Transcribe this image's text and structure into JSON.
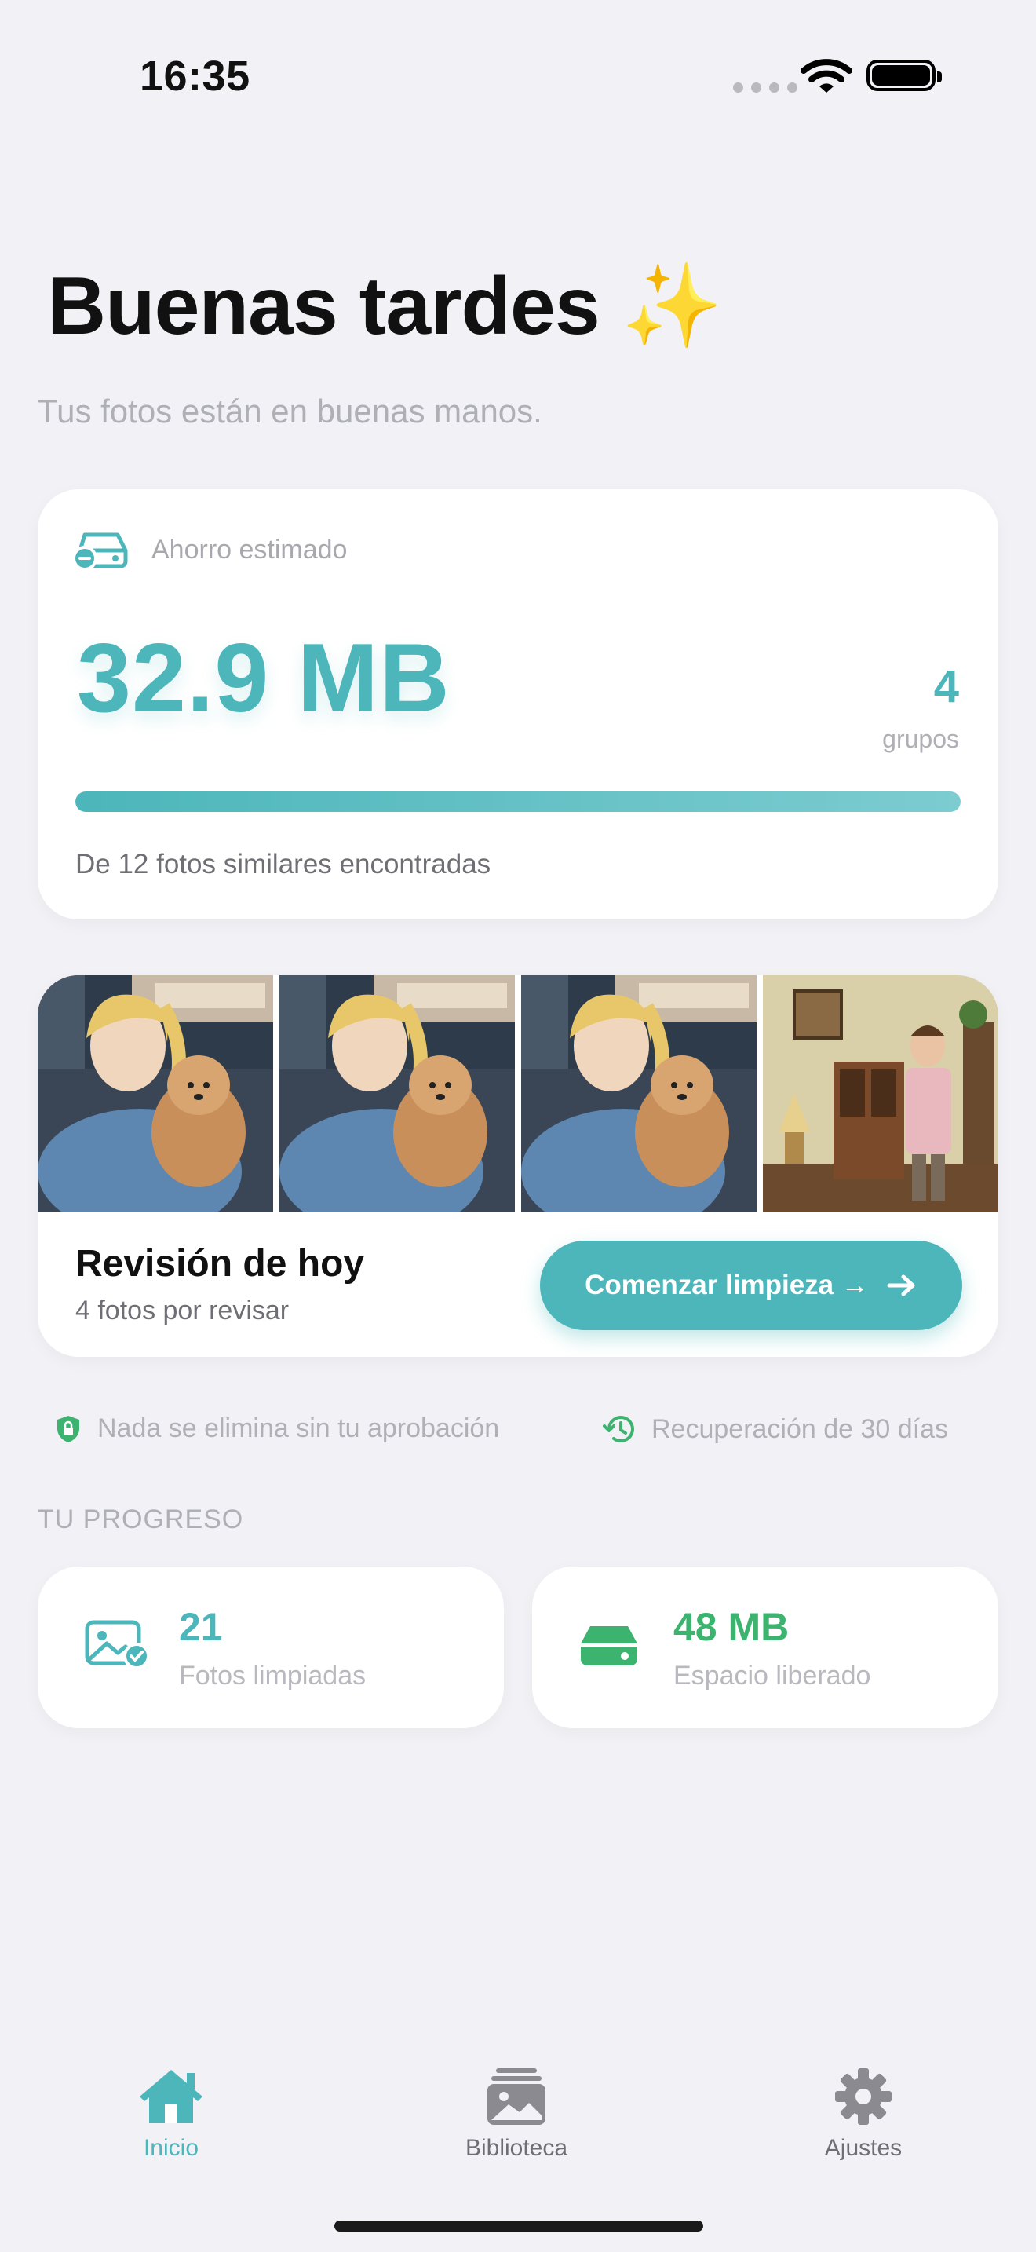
{
  "status_bar": {
    "time": "16:35"
  },
  "greeting": {
    "title": "Buenas tardes ✨",
    "subtitle": "Tus fotos están en buenas manos."
  },
  "savings": {
    "label": "Ahorro estimado",
    "value": "32.9 MB",
    "group_count": "4",
    "group_label": "grupos",
    "progress": 1.0,
    "note": "De 12 fotos similares encontradas"
  },
  "review": {
    "title": "Revisión de hoy",
    "subtitle": "4 fotos por revisar",
    "button_label": "Comenzar limpieza →",
    "thumbnails": [
      "girl-with-puppy-photo",
      "girl-with-puppy-photo",
      "girl-with-puppy-photo",
      "man-in-living-room-photo"
    ]
  },
  "trust": {
    "approval": "Nada se elimina sin tu aprobación",
    "recovery": "Recuperación de 30 días"
  },
  "progress_section": {
    "title": "TU PROGRESO",
    "photos_cleaned": {
      "value": "21",
      "label": "Fotos limpiadas"
    },
    "space_freed": {
      "value": "48 MB",
      "label": "Espacio liberado"
    }
  },
  "tabs": [
    {
      "label": "Inicio",
      "icon": "house-icon",
      "active": true
    },
    {
      "label": "Biblioteca",
      "icon": "photo-stack-icon",
      "active": false
    },
    {
      "label": "Ajustes",
      "icon": "gear-icon",
      "active": false
    }
  ],
  "colors": {
    "accent": "#4CB6BA",
    "green": "#3DB370",
    "background": "#F1F1F6"
  }
}
